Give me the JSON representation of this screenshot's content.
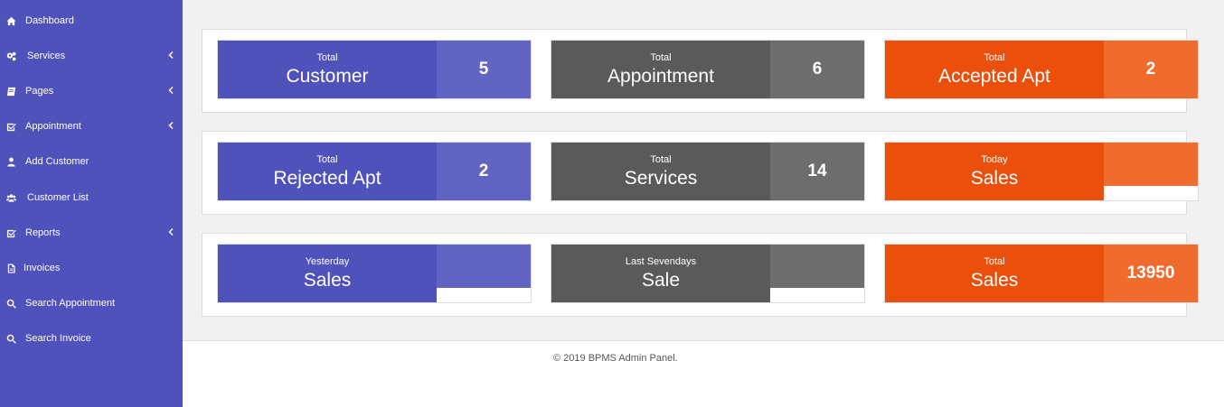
{
  "sidebar": {
    "items": [
      {
        "label": "Dashboard",
        "icon": "home-icon",
        "has_submenu": false
      },
      {
        "label": "Services",
        "icon": "gears-icon",
        "has_submenu": true
      },
      {
        "label": "Pages",
        "icon": "book-icon",
        "has_submenu": true
      },
      {
        "label": "Appointment",
        "icon": "check-square-icon",
        "has_submenu": true
      },
      {
        "label": "Add Customer",
        "icon": "user-icon",
        "has_submenu": false
      },
      {
        "label": "Customer List",
        "icon": "users-icon",
        "has_submenu": false
      },
      {
        "label": "Reports",
        "icon": "check-square-icon",
        "has_submenu": true
      },
      {
        "label": "Invoices",
        "icon": "file-icon",
        "has_submenu": false
      },
      {
        "label": "Search Appointment",
        "icon": "search-icon",
        "has_submenu": false
      },
      {
        "label": "Search Invoice",
        "icon": "search-icon",
        "has_submenu": false
      }
    ]
  },
  "cards": [
    {
      "sub": "Total",
      "title": "Customer",
      "value": "5"
    },
    {
      "sub": "Total",
      "title": "Appointment",
      "value": "6"
    },
    {
      "sub": "Total",
      "title": "Accepted Apt",
      "value": "2"
    },
    {
      "sub": "Total",
      "title": "Rejected Apt",
      "value": "2"
    },
    {
      "sub": "Total",
      "title": "Services",
      "value": "14"
    },
    {
      "sub": "Today",
      "title": "Sales",
      "value": ""
    },
    {
      "sub": "Yesterday",
      "title": "Sales",
      "value": ""
    },
    {
      "sub": "Last Sevendays",
      "title": "Sale",
      "value": ""
    },
    {
      "sub": "Total",
      "title": "Sales",
      "value": "13950"
    }
  ],
  "colors": {
    "sidebar": "#4f52ba",
    "blue": "#4f52ba",
    "gray": "#5a5a5a",
    "orange": "#ea4f0c"
  },
  "footer": {
    "text": "© 2019 BPMS Admin Panel."
  }
}
